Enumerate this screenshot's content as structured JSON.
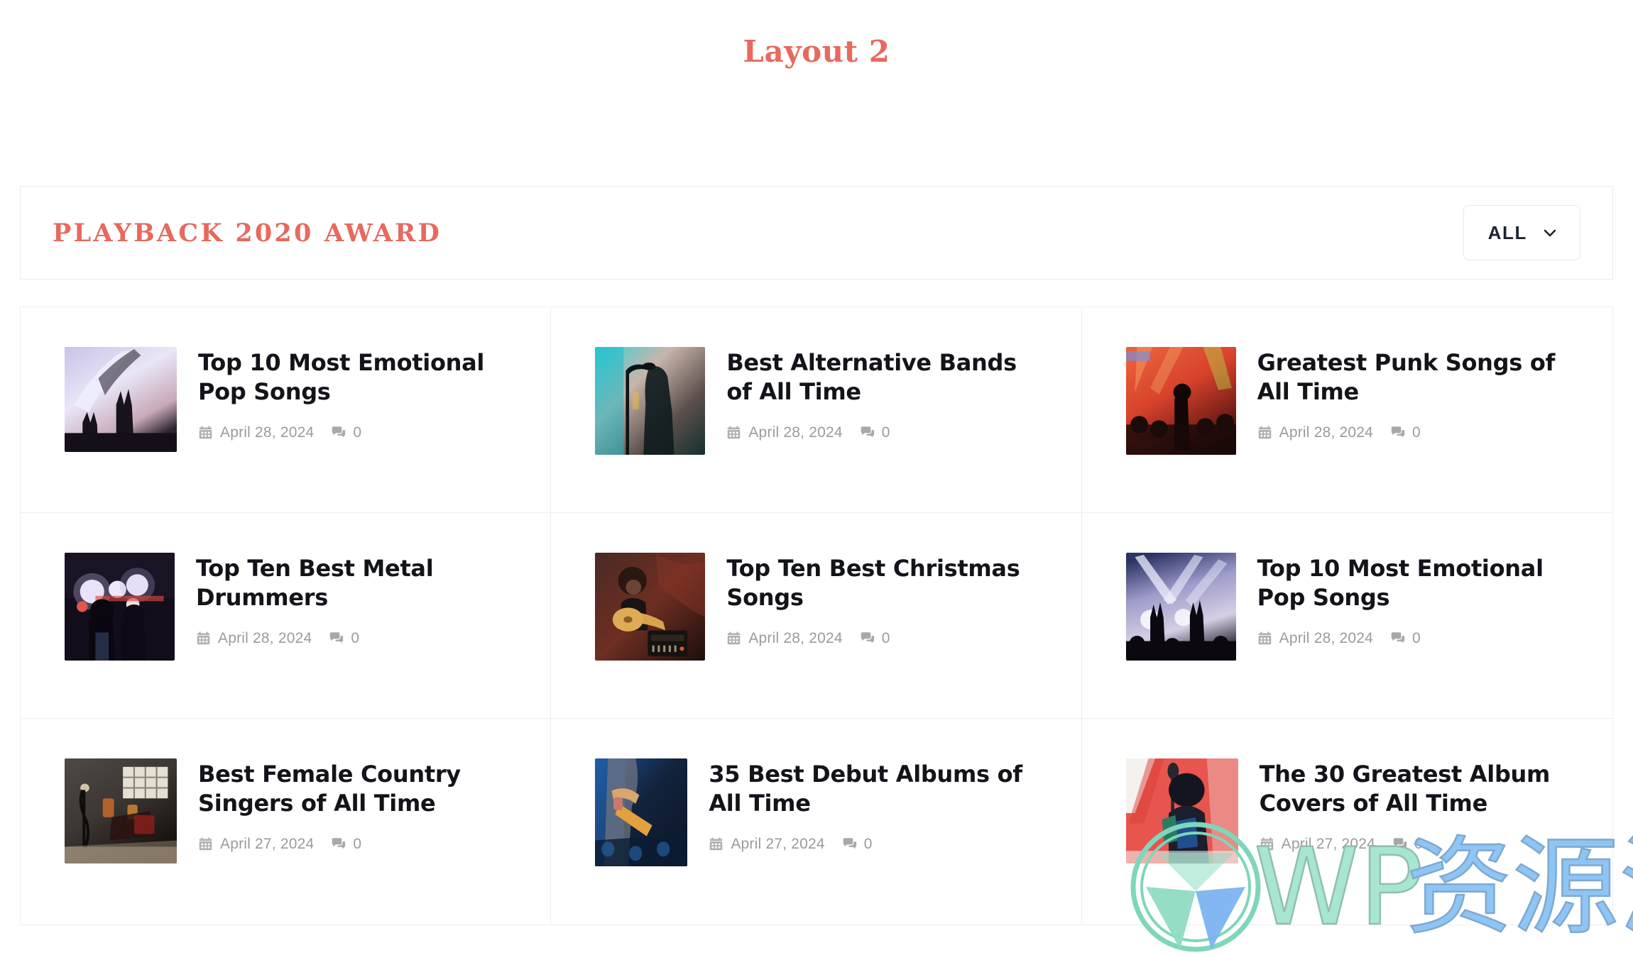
{
  "page": {
    "title": "Layout 2",
    "accent_color": "#e8695e",
    "title_color": "#12141a",
    "meta_color": "#9b9b9b",
    "border_color": "#efefef"
  },
  "section": {
    "heading": "Playback 2020 Award",
    "filter": {
      "label": "ALL",
      "icon": "chevron-down-icon"
    }
  },
  "icons": {
    "calendar": "calendar-icon",
    "comments": "comments-icon"
  },
  "posts": [
    {
      "title": "Top 10 Most Emotional Pop Songs",
      "date": "April 28, 2024",
      "comments": "0",
      "image_alt": "crowd-hands-smoke-lights"
    },
    {
      "title": "Best Alternative Bands of All Time",
      "date": "April 28, 2024",
      "comments": "0",
      "image_alt": "singer-silhouette-teal-stage"
    },
    {
      "title": "Greatest Punk Songs of All Time",
      "date": "April 28, 2024",
      "comments": "0",
      "image_alt": "red-stage-lights-crowd"
    },
    {
      "title": "Top Ten Best Metal Drummers",
      "date": "April 28, 2024",
      "comments": "0",
      "image_alt": "dark-concert-white-red-lights"
    },
    {
      "title": "Top Ten Best Christmas Songs",
      "date": "April 28, 2024",
      "comments": "0",
      "image_alt": "guitarist-with-amp-warm-tones"
    },
    {
      "title": "Top 10 Most Emotional Pop Songs",
      "date": "April 28, 2024",
      "comments": "0",
      "image_alt": "raised-hands-purple-stage-lights"
    },
    {
      "title": "Best Female Country Singers of All Time",
      "date": "April 27, 2024",
      "comments": "0",
      "image_alt": "dim-venue-interior-window-light"
    },
    {
      "title": "35 Best Debut Albums of All Time",
      "date": "April 27, 2024",
      "comments": "0",
      "image_alt": "blue-toned-guitarist"
    },
    {
      "title": "The 30 Greatest Album Covers of All Time",
      "date": "April 27, 2024",
      "comments": "0",
      "image_alt": "performer-red-background"
    }
  ],
  "watermark": {
    "text": "WP资源海",
    "logo": "wordpress-logo-icon"
  }
}
